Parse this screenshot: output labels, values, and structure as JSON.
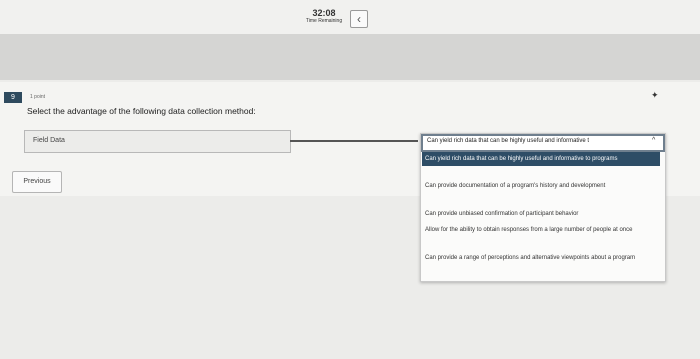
{
  "timer": {
    "time": "32:08",
    "label": "Time Remaining"
  },
  "nav": {
    "back_glyph": "‹"
  },
  "question": {
    "number": "9",
    "points": "1 point",
    "prompt": "Select the advantage of the following data collection method:",
    "star_glyph": "✦"
  },
  "match": {
    "item_label": "Field Data"
  },
  "dropdown": {
    "selected": "Can yield rich data that can be highly useful and informative t",
    "options": [
      "Can yield rich data that can be highly useful and informative to programs",
      "Can provide documentation of a program's history and development",
      "Can provide unbiased confirmation of participant behavior",
      "Allow for the ability to obtain responses from a large number of people at once",
      "Can provide a range of perceptions and alternative viewpoints about a program"
    ],
    "highlighted_index": 0
  },
  "footer": {
    "previous_label": "Previous"
  },
  "colors": {
    "accent": "#2e4d66",
    "badge": "#2e4a5e"
  },
  "icons": {
    "back": "chevron-left-icon",
    "star": "star-icon",
    "chevron": "chevron-up-icon"
  }
}
